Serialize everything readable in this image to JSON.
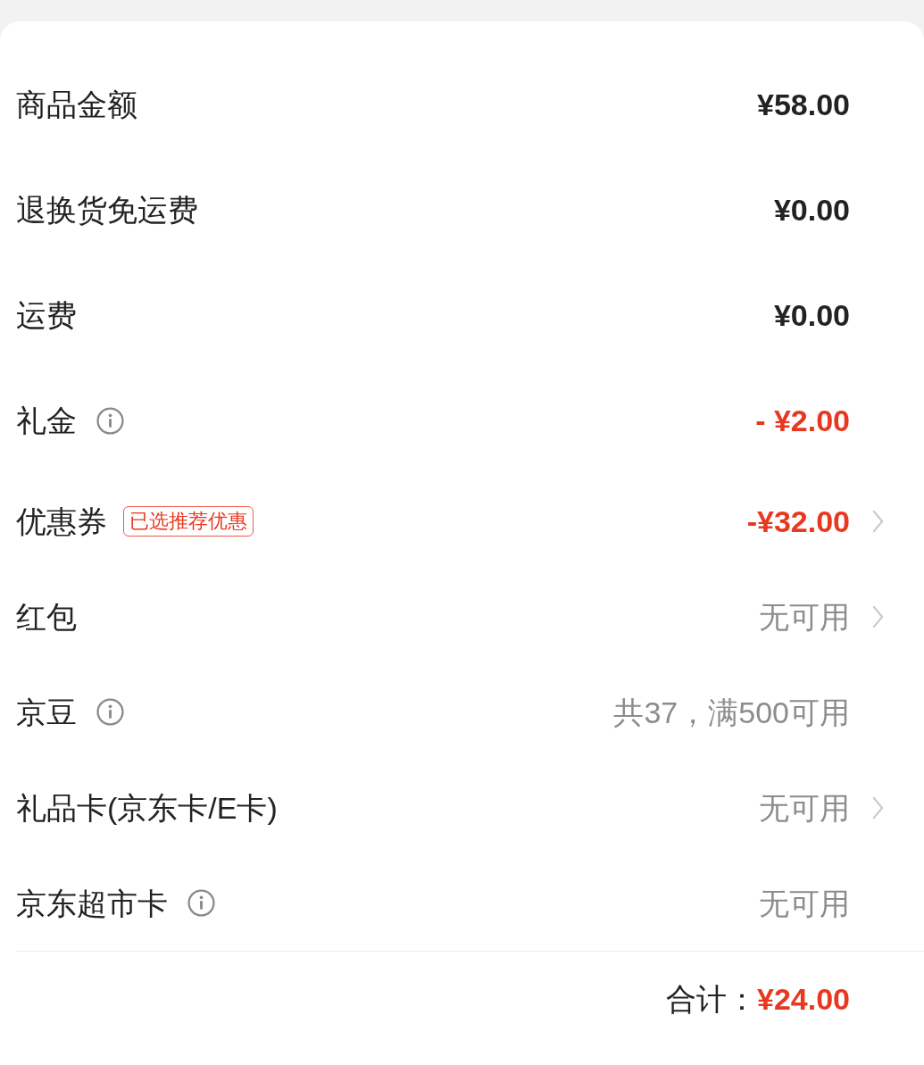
{
  "rows": [
    {
      "label": "商品金额",
      "info": false,
      "value": "¥58.00",
      "kind": "amount",
      "chevron": false
    },
    {
      "label": "退换货免运费",
      "info": false,
      "value": "¥0.00",
      "kind": "amount",
      "chevron": false
    },
    {
      "label": "运费",
      "info": false,
      "value": "¥0.00",
      "kind": "amount",
      "chevron": false
    },
    {
      "label": "礼金",
      "info": true,
      "value": "- ¥2.00",
      "kind": "discount",
      "chevron": false
    },
    {
      "label": "优惠券",
      "info": false,
      "badge": "已选推荐优惠",
      "value": "-¥32.00",
      "kind": "discount",
      "chevron": true
    },
    {
      "label": "红包",
      "info": false,
      "value": "无可用",
      "kind": "muted",
      "chevron": true
    },
    {
      "label": "京豆",
      "info": true,
      "value": "共37，满500可用",
      "kind": "muted",
      "chevron": false
    },
    {
      "label": "礼品卡(京东卡/E卡)",
      "info": false,
      "value": "无可用",
      "kind": "muted",
      "chevron": true
    },
    {
      "label": "京东超市卡",
      "info": true,
      "value": "无可用",
      "kind": "muted",
      "chevron": false
    }
  ],
  "total": {
    "label": "合计：",
    "value": "¥24.00"
  }
}
